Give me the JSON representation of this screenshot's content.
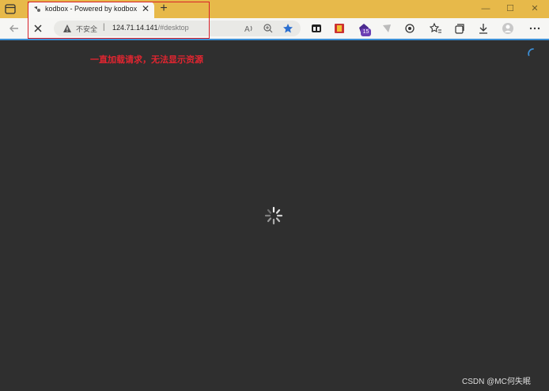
{
  "tab": {
    "title": "kodbox - Powered by kodbox",
    "close": "✕"
  },
  "new_tab": "+",
  "window_controls": {
    "minimize": "—",
    "maximize": "☐",
    "close": "✕"
  },
  "address": {
    "insecure_label": "不安全",
    "separator": "|",
    "url_host": "124.71.14.141",
    "url_rest": "/#desktop"
  },
  "extension_badge": "15",
  "annotation": {
    "text": "一直加载请求，无法显示资源",
    "color": "#e22530"
  },
  "watermark": "CSDN @MC何失眠",
  "colors": {
    "titlebar": "#e7b94a",
    "toolbar": "#f6f6f4",
    "page_bg": "#2f2f2f",
    "accent": "#3c8fd6"
  },
  "icons": [
    "tab-actions-icon",
    "site-favicon",
    "back-arrow-icon",
    "stop-loading-icon",
    "warning-icon",
    "read-aloud-icon",
    "zoom-icon",
    "favorite-star-icon",
    "extension-icons",
    "settings-menu-icon",
    "favorites-icon",
    "collections-icon",
    "downloads-icon",
    "profile-icon",
    "loading-spinner-icon"
  ]
}
